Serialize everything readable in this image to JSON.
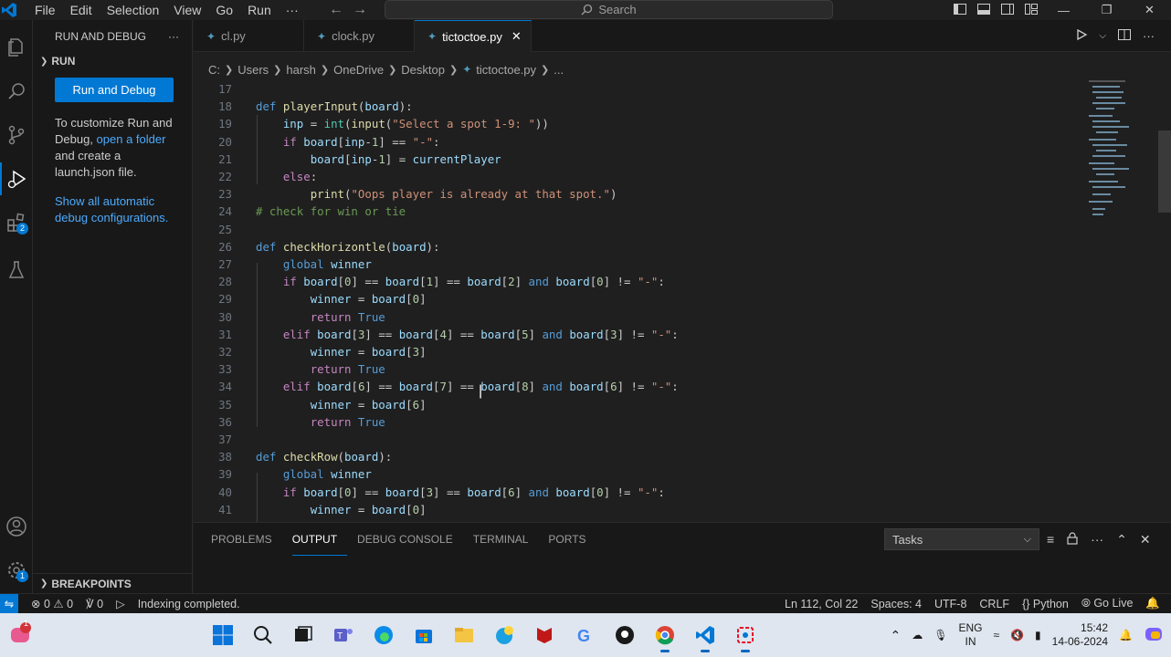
{
  "titlebar": {
    "menu": [
      "File",
      "Edit",
      "Selection",
      "View",
      "Go",
      "Run",
      "···"
    ],
    "search_placeholder": "Search"
  },
  "sidebar": {
    "title": "RUN AND DEBUG",
    "section": "RUN",
    "run_button": "Run and Debug",
    "text1": "To customize Run and Debug,",
    "link1": "open a folder",
    "text2": "and create a launch.json file.",
    "link2": "Show all automatic debug configurations.",
    "breakpoints": "BREAKPOINTS",
    "extensions_badge": "2",
    "settings_badge": "1"
  },
  "tabs": [
    {
      "label": "cl.py"
    },
    {
      "label": "clock.py"
    },
    {
      "label": "tictoctoe.py"
    }
  ],
  "breadcrumb": [
    "C:",
    "Users",
    "harsh",
    "OneDrive",
    "Desktop",
    "tictoctoe.py",
    "..."
  ],
  "editor": {
    "lines": [
      {
        "n": "17",
        "html": ""
      },
      {
        "n": "18",
        "html": "<span class=\"kw\">def</span> <span class=\"fn\">playerInput</span>(<span class=\"var\">board</span>):"
      },
      {
        "n": "19",
        "html": "    <span class=\"var\">inp</span> = <span class=\"bi\">int</span>(<span class=\"fn\">input</span>(<span class=\"str\">\"Select a spot 1-9: \"</span>))"
      },
      {
        "n": "20",
        "html": "    <span class=\"ctl\">if</span> <span class=\"var\">board</span>[<span class=\"var\">inp</span>-<span class=\"num\">1</span>] == <span class=\"str\">\"-\"</span>:"
      },
      {
        "n": "21",
        "html": "        <span class=\"var\">board</span>[<span class=\"var\">inp</span>-<span class=\"num\">1</span>] = <span class=\"var\">currentPlayer</span>"
      },
      {
        "n": "22",
        "html": "    <span class=\"ctl\">else</span>:"
      },
      {
        "n": "23",
        "html": "        <span class=\"fn\">print</span>(<span class=\"str\">\"Oops player is already at that spot.\"</span>)"
      },
      {
        "n": "24",
        "html": "<span class=\"cmt\"># check for win or tie</span>"
      },
      {
        "n": "25",
        "html": ""
      },
      {
        "n": "26",
        "html": "<span class=\"kw\">def</span> <span class=\"fn\">checkHorizontle</span>(<span class=\"var\">board</span>):"
      },
      {
        "n": "27",
        "html": "    <span class=\"kw\">global</span> <span class=\"var\">winner</span>"
      },
      {
        "n": "28",
        "html": "    <span class=\"ctl\">if</span> <span class=\"var\">board</span>[<span class=\"num\">0</span>] == <span class=\"var\">board</span>[<span class=\"num\">1</span>] == <span class=\"var\">board</span>[<span class=\"num\">2</span>] <span class=\"kw\">and</span> <span class=\"var\">board</span>[<span class=\"num\">0</span>] != <span class=\"str\">\"-\"</span>:"
      },
      {
        "n": "29",
        "html": "        <span class=\"var\">winner</span> = <span class=\"var\">board</span>[<span class=\"num\">0</span>]"
      },
      {
        "n": "30",
        "html": "        <span class=\"ctl\">return</span> <span class=\"kw\">True</span>"
      },
      {
        "n": "31",
        "html": "    <span class=\"ctl\">elif</span> <span class=\"var\">board</span>[<span class=\"num\">3</span>] == <span class=\"var\">board</span>[<span class=\"num\">4</span>] == <span class=\"var\">board</span>[<span class=\"num\">5</span>] <span class=\"kw\">and</span> <span class=\"var\">board</span>[<span class=\"num\">3</span>] != <span class=\"str\">\"-\"</span>:"
      },
      {
        "n": "32",
        "html": "        <span class=\"var\">winner</span> = <span class=\"var\">board</span>[<span class=\"num\">3</span>]"
      },
      {
        "n": "33",
        "html": "        <span class=\"ctl\">return</span> <span class=\"kw\">True</span>"
      },
      {
        "n": "34",
        "html": "    <span class=\"ctl\">elif</span> <span class=\"var\">board</span>[<span class=\"num\">6</span>] == <span class=\"var\">board</span>[<span class=\"num\">7</span>] == <span class=\"var\">board</span>[<span class=\"num\">8</span>] <span class=\"kw\">and</span> <span class=\"var\">board</span>[<span class=\"num\">6</span>] != <span class=\"str\">\"-\"</span>:"
      },
      {
        "n": "35",
        "html": "        <span class=\"var\">winner</span> = <span class=\"var\">board</span>[<span class=\"num\">6</span>]"
      },
      {
        "n": "36",
        "html": "        <span class=\"ctl\">return</span> <span class=\"kw\">True</span>"
      },
      {
        "n": "37",
        "html": ""
      },
      {
        "n": "38",
        "html": "<span class=\"kw\">def</span> <span class=\"fn\">checkRow</span>(<span class=\"var\">board</span>):"
      },
      {
        "n": "39",
        "html": "    <span class=\"kw\">global</span> <span class=\"var\">winner</span>"
      },
      {
        "n": "40",
        "html": "    <span class=\"ctl\">if</span> <span class=\"var\">board</span>[<span class=\"num\">0</span>] == <span class=\"var\">board</span>[<span class=\"num\">3</span>] == <span class=\"var\">board</span>[<span class=\"num\">6</span>] <span class=\"kw\">and</span> <span class=\"var\">board</span>[<span class=\"num\">0</span>] != <span class=\"str\">\"-\"</span>:"
      },
      {
        "n": "41",
        "html": "        <span class=\"var\">winner</span> = <span class=\"var\">board</span>[<span class=\"num\">0</span>]"
      }
    ]
  },
  "panel": {
    "tabs": [
      "PROBLEMS",
      "OUTPUT",
      "DEBUG CONSOLE",
      "TERMINAL",
      "PORTS"
    ],
    "active_tab": "OUTPUT",
    "tasks_select": "Tasks"
  },
  "statusbar": {
    "errors": "0",
    "warnings": "0",
    "ports": "0",
    "message": "Indexing completed.",
    "position": "Ln 112, Col 22",
    "spaces": "Spaces: 4",
    "encoding": "UTF-8",
    "eol": "CRLF",
    "language": "Python",
    "golive": "Go Live"
  },
  "taskbar": {
    "lang1": "ENG",
    "lang2": "IN",
    "time": "15:42",
    "date": "14-06-2024",
    "notif_badge": "1"
  },
  "colors": {
    "accent": "#0078d4",
    "editor_bg": "#1f1f1f",
    "sidebar_bg": "#181818",
    "taskbar_bg": "#dfe6f0"
  }
}
